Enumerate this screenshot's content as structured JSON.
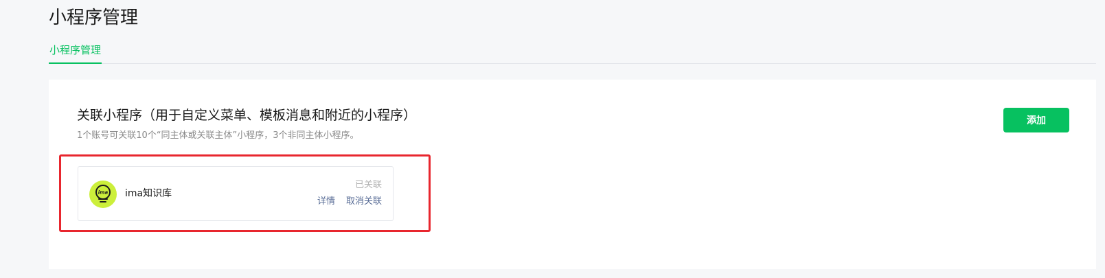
{
  "header": {
    "title": "小程序管理"
  },
  "tabs": [
    {
      "label": "小程序管理",
      "active": true
    }
  ],
  "section": {
    "title": "关联小程序（用于自定义菜单、模板消息和附近的小程序）",
    "description": "1个账号可关联10个“同主体或关联主体”小程序，3个非同主体小程序。",
    "add_label": "添加"
  },
  "linked_apps": [
    {
      "name": "ima知识库",
      "avatar_text": "ima",
      "status": "已关联",
      "actions": {
        "details": "详情",
        "unlink": "取消关联"
      }
    }
  ],
  "colors": {
    "accent": "#07c160",
    "link": "#576b95",
    "highlight": "#e8262e",
    "avatar_bg": "#ccef3b",
    "page_bg": "#f6f7f9"
  },
  "icons": {
    "app_avatar": "lightbulb-icon"
  }
}
